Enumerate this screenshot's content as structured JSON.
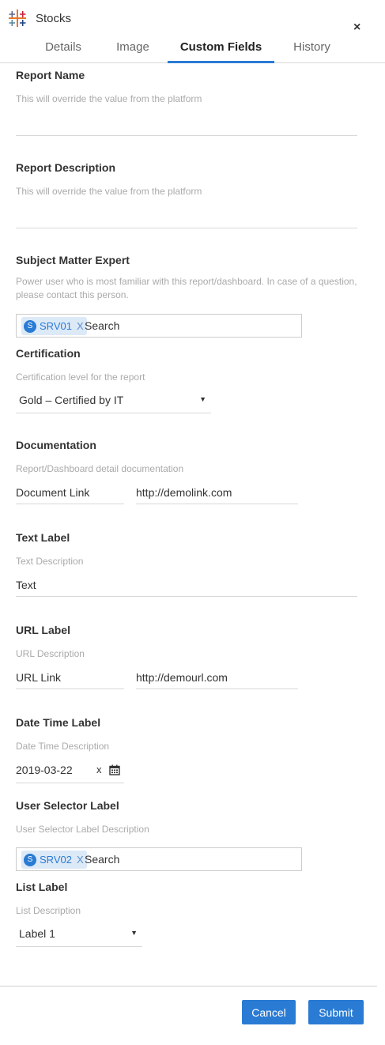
{
  "header": {
    "app_title": "Stocks",
    "close_symbol": "×",
    "logo_icon": "tableau-logo-icon"
  },
  "tabs": [
    {
      "label": "Details"
    },
    {
      "label": "Image"
    },
    {
      "label": "Custom Fields",
      "active": true
    },
    {
      "label": "History"
    }
  ],
  "fields": {
    "report_name": {
      "title": "Report Name",
      "description": "This will override the value from the platform",
      "value": ""
    },
    "report_description": {
      "title": "Report Description",
      "description": "This will override the value from the platform",
      "value": ""
    },
    "sme": {
      "title": "Subject Matter Expert",
      "description": "Power user who is most familiar with this report/dashboard. In case of a question, please contact this person.",
      "tag_avatar": "S",
      "tag_label": "SRV01",
      "tag_remove": "X",
      "search_placeholder": "Search"
    },
    "certification": {
      "title": "Certification",
      "description": "Certification level for the report",
      "selected": "Gold – Certified by IT",
      "arrow": "▼"
    },
    "documentation": {
      "title": "Documentation",
      "description": "Report/Dashboard detail documentation",
      "link_label": "Document Link",
      "link_url": "http://demolink.com"
    },
    "text": {
      "title": "Text Label",
      "description": "Text Description",
      "value": "Text"
    },
    "url": {
      "title": "URL Label",
      "description": "URL Description",
      "link_label": "URL Link",
      "link_url": "http://demourl.com"
    },
    "datetime": {
      "title": "Date Time Label",
      "description": "Date Time Description",
      "value": "2019-03-22",
      "clear": "x"
    },
    "user_selector": {
      "title": "User Selector Label",
      "description": "User Selector Label Description",
      "tag_avatar": "S",
      "tag_label": "SRV02",
      "tag_remove": "X",
      "search_placeholder": "Search"
    },
    "list": {
      "title": "List Label",
      "description": "List Description",
      "selected": "Label 1",
      "arrow": "▼"
    }
  },
  "footer": {
    "cancel_label": "Cancel",
    "submit_label": "Submit"
  },
  "colors": {
    "accent": "#2a7bd4",
    "tag_bg": "#dce9f7"
  }
}
